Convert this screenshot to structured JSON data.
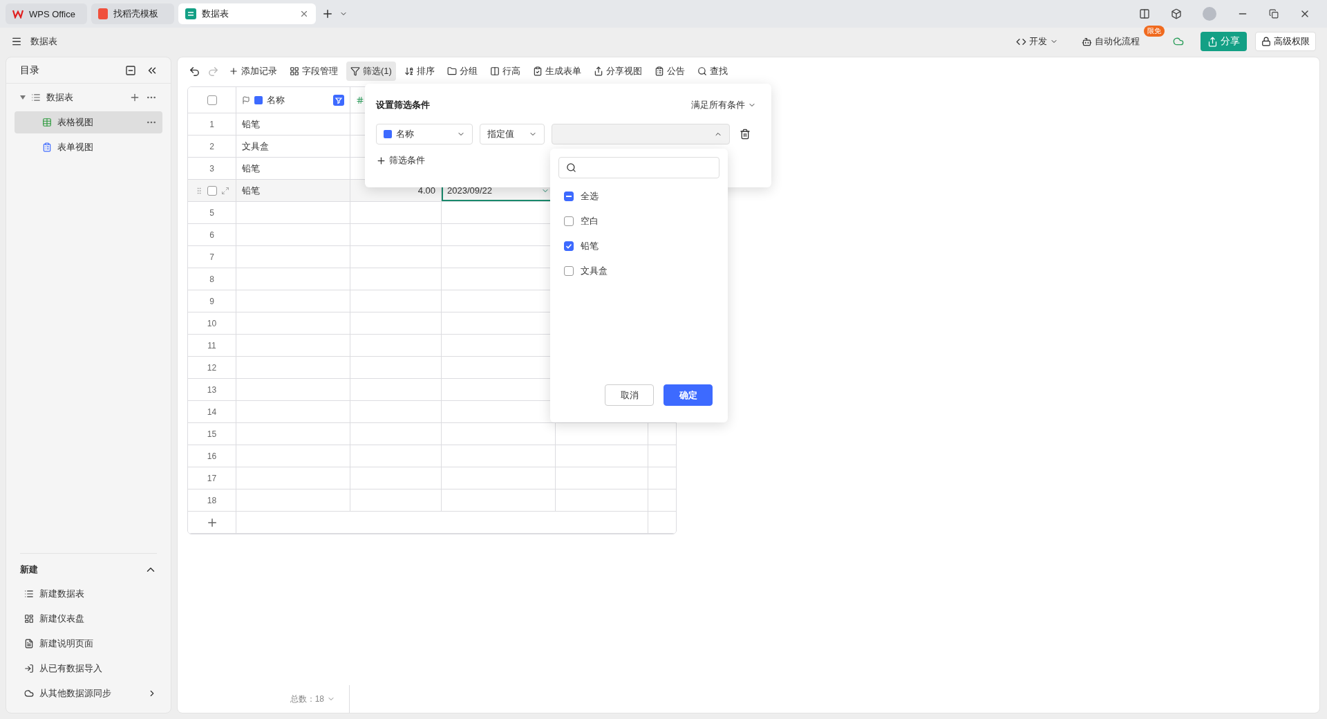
{
  "browser_tabs": [
    {
      "label": "WPS Office",
      "selected": false
    },
    {
      "label": "找稻壳模板",
      "selected": false
    },
    {
      "label": "数据表",
      "selected": true
    }
  ],
  "app_bar": {
    "title": "数据表",
    "dev_menu": "开发",
    "automation": "自动化流程",
    "automation_badge": "限免",
    "share": "分享",
    "permissions": "高级权限"
  },
  "sidebar": {
    "title": "目录",
    "tree": [
      {
        "label": "数据表",
        "expanded": true,
        "children": [
          {
            "label": "表格视图",
            "kind": "grid",
            "selected": true
          },
          {
            "label": "表单视图",
            "kind": "form",
            "selected": false
          }
        ]
      }
    ],
    "new_section": {
      "title": "新建",
      "expanded": true,
      "items": [
        {
          "label": "新建数据表",
          "kind": "table"
        },
        {
          "label": "新建仪表盘",
          "kind": "dashboard"
        },
        {
          "label": "新建说明页面",
          "kind": "doc"
        },
        {
          "label": "从已有数据导入",
          "kind": "import"
        },
        {
          "label": "从其他数据源同步",
          "kind": "sync"
        }
      ]
    }
  },
  "toolbar": [
    {
      "label": "添加记录",
      "active": false
    },
    {
      "label": "字段管理",
      "active": false
    },
    {
      "label": "筛选(1)",
      "active": true
    },
    {
      "label": "排序",
      "active": false
    },
    {
      "label": "分组",
      "active": false
    },
    {
      "label": "行高",
      "active": false
    },
    {
      "label": "生成表单",
      "active": false
    },
    {
      "label": "分享视图",
      "active": false
    },
    {
      "label": "公告",
      "active": false
    },
    {
      "label": "查找",
      "active": false
    }
  ],
  "table": {
    "all_checked": false,
    "name_column": {
      "label": "名称",
      "filtered": true
    },
    "rows": [
      {
        "number": "1",
        "hovered": false,
        "cells": [
          {
            "text": "铅笔",
            "selected": false
          }
        ]
      },
      {
        "number": "2",
        "hovered": false,
        "cells": [
          {
            "text": "文具盒",
            "selected": false
          }
        ]
      },
      {
        "number": "3",
        "hovered": false,
        "cells": [
          {
            "text": "铅笔",
            "selected": false
          }
        ]
      },
      {
        "hovered": true,
        "checked": false,
        "cells": [
          {
            "text": "铅笔",
            "selected": false
          },
          {
            "text": "4.00",
            "selected": false
          },
          {
            "text": "2023/09/22",
            "selected": true
          }
        ]
      },
      {
        "number": "5",
        "hovered": false,
        "cells": []
      },
      {
        "number": "6",
        "hovered": false,
        "cells": []
      },
      {
        "number": "7",
        "hovered": false,
        "cells": []
      },
      {
        "number": "8",
        "hovered": false,
        "cells": []
      },
      {
        "number": "9",
        "hovered": false,
        "cells": []
      },
      {
        "number": "10",
        "hovered": false,
        "cells": []
      },
      {
        "number": "11",
        "hovered": false,
        "cells": []
      },
      {
        "number": "12",
        "hovered": false,
        "cells": []
      },
      {
        "number": "13",
        "hovered": false,
        "cells": []
      },
      {
        "number": "14",
        "hovered": false,
        "cells": []
      },
      {
        "number": "15",
        "hovered": false,
        "cells": []
      },
      {
        "number": "16",
        "hovered": false,
        "cells": []
      },
      {
        "number": "17",
        "hovered": false,
        "cells": []
      },
      {
        "number": "18",
        "hovered": false,
        "cells": []
      }
    ],
    "total": "总数：18"
  },
  "filter_panel": {
    "title": "设置筛选条件",
    "match": "满足所有条件",
    "field": "名称",
    "operator": "指定值",
    "add_condition": "筛选条件"
  },
  "value_dropdown": {
    "options": [
      {
        "label": "全选",
        "indeterminate": true
      },
      {
        "label": "空白",
        "checked": false
      },
      {
        "label": "铅笔",
        "checked": true
      },
      {
        "label": "文具盒",
        "checked": false
      }
    ],
    "cancel": "取消",
    "confirm": "确定"
  }
}
